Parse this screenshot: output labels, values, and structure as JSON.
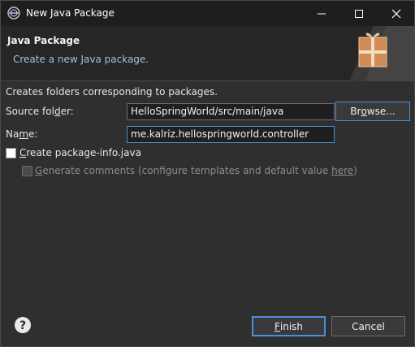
{
  "window": {
    "title": "New Java Package",
    "controls": {
      "minimize": "—",
      "maximize": "☐",
      "close": "✕"
    }
  },
  "banner": {
    "title": "Java Package",
    "description": "Create a new Java package."
  },
  "body": {
    "intro": "Creates folders corresponding to packages.",
    "source_folder": {
      "label_pre": "Source fol",
      "label_u": "d",
      "label_post": "er:",
      "value": "HelloSpringWorld/src/main/java",
      "browse_pre": "Br",
      "browse_u": "o",
      "browse_post": "wse..."
    },
    "name": {
      "label_pre": "Na",
      "label_u": "m",
      "label_post": "e:",
      "value": "me.kalriz.hellospringworld.controller"
    },
    "create_package_info": {
      "label_u": "C",
      "label_post": "reate package-info.java",
      "checked": false
    },
    "generate_comments": {
      "label_u": "G",
      "label_post": "enerate comments",
      "paren_pre": "(configure templates and default value ",
      "link": "here",
      "paren_post": ")",
      "checked": false,
      "enabled": false
    }
  },
  "footer": {
    "help_icon": "question-circle-icon",
    "finish_u": "F",
    "finish_post": "inish",
    "cancel_label": "Cancel"
  },
  "colors": {
    "background": "#2f2f2f",
    "titlebar": "#1e1e1e",
    "banner": "#262626",
    "accent": "#4a90d9",
    "banner_desc": "#9ec3e0"
  }
}
